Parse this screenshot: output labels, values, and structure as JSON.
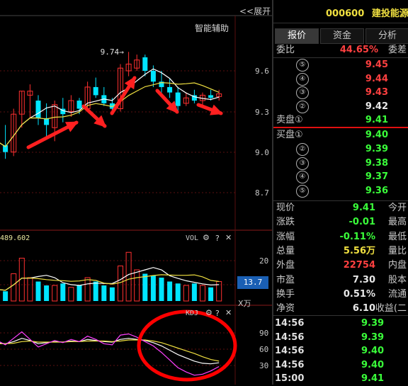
{
  "header": {
    "expand_label": "<<展开",
    "stock_code": "000600",
    "stock_name": "建投能源"
  },
  "chart": {
    "smart_assist_label": "智能辅助",
    "high_marker": "9.74",
    "price_axis": [
      "9.6",
      "9.3",
      "9.0",
      "8.7"
    ],
    "volume_pane": {
      "value": "489.602",
      "label": "VOL",
      "axis": [
        "20"
      ],
      "current": "13.7",
      "unit": "X万"
    },
    "kdj_pane": {
      "label": "KDJ",
      "axis": [
        "90",
        "60",
        "30"
      ]
    },
    "colors": {
      "up": "#ff3030",
      "down": "#00e5ff",
      "ma5": "#ffffff",
      "ma10": "#f0e040",
      "ma20": "#ff40ff",
      "arrow": "#ff2020",
      "circle": "#ff0000"
    }
  },
  "chart_data": {
    "type": "candlestick",
    "title": "",
    "ylim": [
      8.6,
      9.8
    ],
    "candles": [
      {
        "o": 8.9,
        "h": 9.12,
        "l": 8.86,
        "c": 9.08
      },
      {
        "o": 9.05,
        "h": 9.2,
        "l": 8.95,
        "c": 9.0
      },
      {
        "o": 9.0,
        "h": 9.32,
        "l": 8.97,
        "c": 9.28
      },
      {
        "o": 9.28,
        "h": 9.45,
        "l": 9.18,
        "c": 9.45
      },
      {
        "o": 9.42,
        "h": 9.5,
        "l": 9.25,
        "c": 9.45
      },
      {
        "o": 9.38,
        "h": 9.42,
        "l": 9.2,
        "c": 9.25
      },
      {
        "o": 9.25,
        "h": 9.36,
        "l": 9.1,
        "c": 9.2
      },
      {
        "o": 9.18,
        "h": 9.38,
        "l": 9.08,
        "c": 9.35
      },
      {
        "o": 9.32,
        "h": 9.4,
        "l": 9.22,
        "c": 9.28
      },
      {
        "o": 9.3,
        "h": 9.42,
        "l": 9.26,
        "c": 9.38
      },
      {
        "o": 9.38,
        "h": 9.4,
        "l": 9.28,
        "c": 9.32
      },
      {
        "o": 9.32,
        "h": 9.52,
        "l": 9.3,
        "c": 9.48
      },
      {
        "o": 9.48,
        "h": 9.55,
        "l": 9.4,
        "c": 9.42
      },
      {
        "o": 9.42,
        "h": 9.48,
        "l": 9.34,
        "c": 9.36
      },
      {
        "o": 9.36,
        "h": 9.4,
        "l": 9.28,
        "c": 9.32
      },
      {
        "o": 9.32,
        "h": 9.65,
        "l": 9.3,
        "c": 9.62
      },
      {
        "o": 9.6,
        "h": 9.74,
        "l": 9.56,
        "c": 9.65
      },
      {
        "o": 9.62,
        "h": 9.72,
        "l": 9.6,
        "c": 9.68
      },
      {
        "o": 9.7,
        "h": 9.72,
        "l": 9.56,
        "c": 9.6
      },
      {
        "o": 9.6,
        "h": 9.64,
        "l": 9.48,
        "c": 9.52
      },
      {
        "o": 9.52,
        "h": 9.6,
        "l": 9.44,
        "c": 9.48
      },
      {
        "o": 9.48,
        "h": 9.54,
        "l": 9.4,
        "c": 9.44
      },
      {
        "o": 9.44,
        "h": 9.48,
        "l": 9.3,
        "c": 9.34
      },
      {
        "o": 9.36,
        "h": 9.44,
        "l": 9.34,
        "c": 9.4
      },
      {
        "o": 9.42,
        "h": 9.46,
        "l": 9.36,
        "c": 9.38
      },
      {
        "o": 9.38,
        "h": 9.44,
        "l": 9.34,
        "c": 9.42
      },
      {
        "o": 9.42,
        "h": 9.46,
        "l": 9.38,
        "c": 9.4
      },
      {
        "o": 9.41,
        "h": 9.46,
        "l": 9.38,
        "c": 9.43
      }
    ],
    "volume": [
      6,
      5,
      14,
      22,
      12,
      10,
      8,
      8,
      9,
      7,
      8,
      12,
      10,
      8,
      7,
      18,
      25,
      16,
      14,
      13,
      12,
      10,
      9,
      8,
      9,
      8,
      7,
      10
    ],
    "kdj": {
      "k": [
        72,
        70,
        74,
        80,
        76,
        70,
        72,
        74,
        73,
        75,
        74,
        78,
        76,
        74,
        73,
        78,
        80,
        78,
        76,
        72,
        66,
        58,
        50,
        44,
        38,
        34,
        33,
        35
      ],
      "d": [
        70,
        70,
        71,
        74,
        75,
        73,
        73,
        73,
        73,
        74,
        74,
        75,
        75,
        75,
        74,
        75,
        77,
        77,
        77,
        75,
        72,
        67,
        62,
        57,
        52,
        46,
        41,
        38
      ],
      "j": [
        76,
        68,
        80,
        92,
        78,
        64,
        70,
        76,
        72,
        78,
        74,
        84,
        78,
        70,
        68,
        86,
        88,
        82,
        74,
        66,
        54,
        40,
        26,
        18,
        12,
        14,
        20,
        28
      ]
    }
  },
  "quote": {
    "tabs": [
      "报价",
      "资金",
      "分析"
    ],
    "ratio_label": "委比",
    "ratio_value": "44.65%",
    "diff_label": "委差",
    "sell": [
      {
        "num": "⑤",
        "price": "9.45",
        "color": "red"
      },
      {
        "num": "④",
        "price": "9.44",
        "color": "red"
      },
      {
        "num": "③",
        "price": "9.43",
        "color": "red"
      },
      {
        "num": "②",
        "price": "9.42",
        "color": "white"
      },
      {
        "num": "卖盘①",
        "price": "9.41",
        "color": "green"
      }
    ],
    "buy": [
      {
        "num": "买盘①",
        "price": "9.40",
        "color": "green"
      },
      {
        "num": "②",
        "price": "9.39",
        "color": "green"
      },
      {
        "num": "③",
        "price": "9.38",
        "color": "green"
      },
      {
        "num": "④",
        "price": "9.37",
        "color": "green"
      },
      {
        "num": "⑤",
        "price": "9.36",
        "color": "green"
      }
    ],
    "stats": [
      {
        "label": "现价",
        "value": "9.41",
        "color": "green",
        "label2": "今开"
      },
      {
        "label": "涨跌",
        "value": "-0.01",
        "color": "green",
        "label2": "最高"
      },
      {
        "label": "涨幅",
        "value": "-0.11%",
        "color": "green",
        "label2": "最低"
      },
      {
        "label": "总量",
        "value": "5.56万",
        "color": "yellow",
        "label2": "量比"
      },
      {
        "label": "外盘",
        "value": "22754",
        "color": "red",
        "label2": "内盘"
      },
      {
        "label": "市盈",
        "value": "7.30",
        "color": "white",
        "label2": "股本"
      },
      {
        "label": "换手",
        "value": "0.51%",
        "color": "white",
        "label2": "流通"
      },
      {
        "label": "净资",
        "value": "6.10",
        "color": "white",
        "label2": "收益(二"
      }
    ],
    "ticks": [
      {
        "time": "14:56",
        "price": "9.39"
      },
      {
        "time": "14:56",
        "price": "9.39"
      },
      {
        "time": "14:56",
        "price": "9.40"
      },
      {
        "time": "14:56",
        "price": "9.40"
      },
      {
        "time": "15:00",
        "price": "9.41"
      }
    ]
  }
}
